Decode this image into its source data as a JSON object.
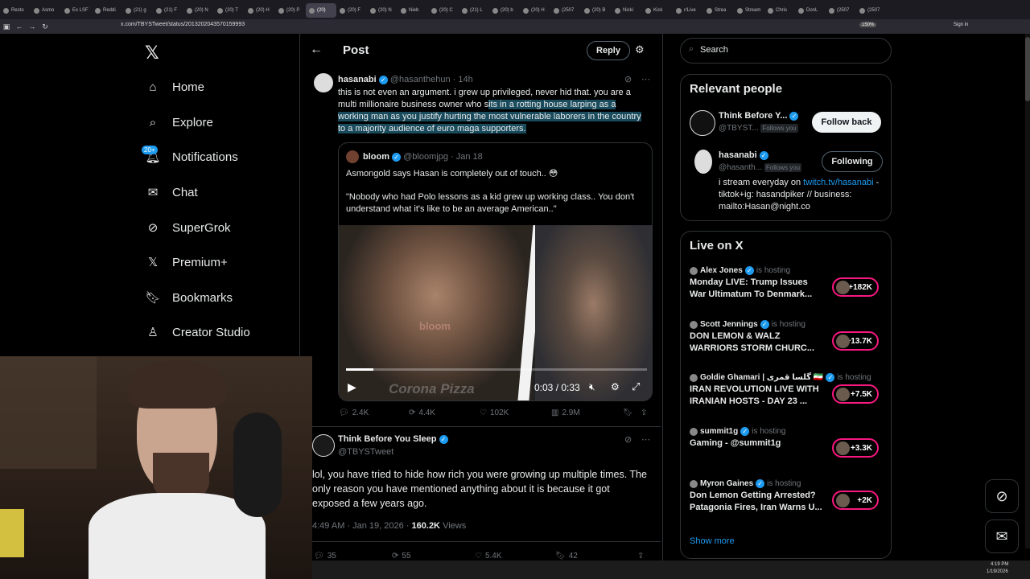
{
  "browser": {
    "tabs": [
      "Resto",
      "Asmo",
      "Ex LSF",
      "Reddi",
      "(21) g",
      "(21) F",
      "(20) N",
      "(20) T",
      "(20) H",
      "(20) P",
      "(20)",
      "(20) F",
      "(20) N",
      "Nieb",
      "(20) C",
      "(21) L",
      "(20) b",
      "(20) H",
      "(2507",
      "(20) B",
      "Nicki",
      "Kick",
      "r/Live",
      "Strea",
      "Stream",
      "Chris",
      "DonL",
      "(2507",
      "(2507"
    ],
    "url": "x.com/TBYSTweet/status/2013202043570159993",
    "zoom": "150%",
    "sign_in": "Sign in"
  },
  "nav": {
    "items": [
      {
        "label": "Home",
        "icon": "home-icon"
      },
      {
        "label": "Explore",
        "icon": "search-icon"
      },
      {
        "label": "Notifications",
        "icon": "bell-icon"
      },
      {
        "label": "Chat",
        "icon": "mail-icon"
      },
      {
        "label": "SuperGrok",
        "icon": "grok-icon"
      },
      {
        "label": "Premium+",
        "icon": "x-logo-icon"
      },
      {
        "label": "Bookmarks",
        "icon": "bookmark-icon"
      },
      {
        "label": "Creator Studio",
        "icon": "creator-icon"
      }
    ],
    "notifications_badge": "20+"
  },
  "header": {
    "title": "Post",
    "reply": "Reply"
  },
  "main_tweet": {
    "author": "hasanabi",
    "handle": "@hasanthehun",
    "time": "· 14h",
    "text_plain": "this is not even an argument. i grew up privileged, never hid that. you are a multi millionaire business owner who s",
    "text_highlight": "its in a rotting house larping as a working man as you justify hurting the most vulnerable laborers in the country to a majority audience of euro maga supporters.",
    "quote": {
      "author": "bloom",
      "handle": "@bloomjpg",
      "time": "· Jan 18",
      "line1": "Asmongold says Hasan is completely out of touch.. 😳",
      "line2": "\"Nobody who had Polo lessons as a kid grew up working class.. You don't understand what it's like to be an average American..\""
    },
    "video": {
      "time": "0:03 / 0:33",
      "watermark": "Corona Pizza",
      "overlay": "bloom",
      "progress": 0.09
    },
    "stats": {
      "replies": "2.4K",
      "reposts": "4.4K",
      "likes": "102K",
      "views": "2.9M"
    }
  },
  "reply_tweet": {
    "author": "Think Before You Sleep",
    "handle": "@TBYSTweet",
    "text": "lol, you have tried to hide how rich you were growing up multiple times. The only reason you have mentioned anything about it is because it got exposed a few years ago.",
    "time": "4:49 AM · Jan 19, 2026 ·",
    "views_count": "160.2K",
    "views_label": "Views",
    "stats": {
      "replies": "35",
      "reposts": "55",
      "likes": "5.4K",
      "bookmarks": "42"
    }
  },
  "search": {
    "placeholder": "Search"
  },
  "relevant": {
    "title": "Relevant people",
    "people": [
      {
        "name": "Think Before Y...",
        "handle": "@TBYST...",
        "follows_you": "Follows you",
        "button": "Follow back"
      },
      {
        "name": "hasanabi",
        "handle": "@hasanth...",
        "follows_you": "Follows you",
        "button": "Following",
        "bio_prefix": "i stream everyday on ",
        "bio_link": "twitch.tv/hasanabi",
        "bio_rest": " - tiktok+ig: hasandpiker // business: mailto:Hasan@night.co"
      }
    ]
  },
  "live": {
    "title": "Live on X",
    "hosting_label": "is hosting",
    "items": [
      {
        "host": "Alex Jones",
        "title": "Monday LIVE: Trump Issues War Ultimatum To Denmark...",
        "count": "+182K"
      },
      {
        "host": "Scott Jennings",
        "title": "DON LEMON & WALZ WARRIORS STORM CHURC...",
        "count": "+13.7K"
      },
      {
        "host": "Goldie Ghamari | گلسا قمری 🇮🇷",
        "title": "IRAN REVOLUTION LIVE WITH IRANIAN HOSTS - DAY 23 ...",
        "count": "+7.5K"
      },
      {
        "host": "summit1g",
        "title": "Gaming - @summit1g",
        "count": "+3.3K"
      },
      {
        "host": "Myron Gaines",
        "title": "Don Lemon Getting Arrested? Patagonia Fires, Iran Warns U...",
        "count": "+2K"
      }
    ],
    "show_more": "Show more"
  },
  "taskbar": {
    "time": "4:19 PM",
    "date": "1/19/2026"
  },
  "colors": {
    "accent": "#1d9bf0",
    "live": "#f91880",
    "highlight": "#1a4b5c"
  }
}
